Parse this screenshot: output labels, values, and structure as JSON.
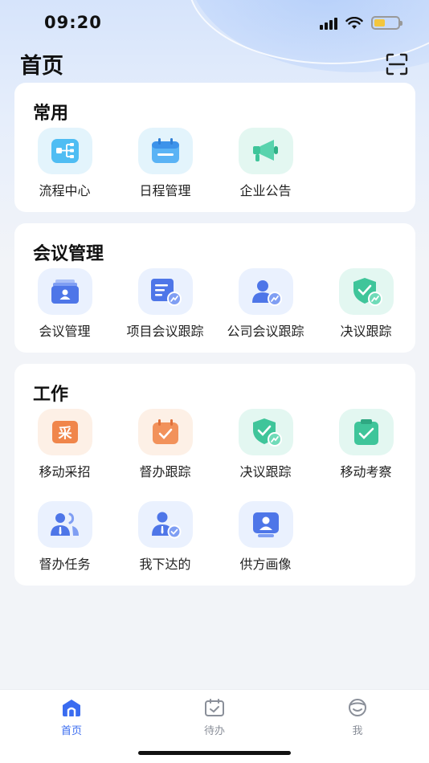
{
  "status_bar": {
    "time": "09:20"
  },
  "header": {
    "title": "首页"
  },
  "sections": {
    "common": {
      "title": "常用",
      "items": [
        {
          "label": "流程中心",
          "icon": "flow-icon"
        },
        {
          "label": "日程管理",
          "icon": "calendar-icon"
        },
        {
          "label": "企业公告",
          "icon": "megaphone-icon"
        }
      ]
    },
    "meeting": {
      "title": "会议管理",
      "items": [
        {
          "label": "会议管理",
          "icon": "meeting-icon"
        },
        {
          "label": "项目会议跟踪",
          "icon": "project-tracking-icon"
        },
        {
          "label": "公司会议跟踪",
          "icon": "company-tracking-icon"
        },
        {
          "label": "决议跟踪",
          "icon": "resolution-shield-icon"
        }
      ]
    },
    "work": {
      "title": "工作",
      "items": [
        {
          "label": "移动采招",
          "icon": "procurement-icon",
          "badge": "采"
        },
        {
          "label": "督办跟踪",
          "icon": "supervise-calendar-icon"
        },
        {
          "label": "决议跟踪",
          "icon": "resolution-shield-icon"
        },
        {
          "label": "移动考察",
          "icon": "clipboard-check-icon"
        },
        {
          "label": "督办任务",
          "icon": "team-task-icon"
        },
        {
          "label": "我下达的",
          "icon": "issued-user-icon"
        },
        {
          "label": "供方画像",
          "icon": "supplier-profile-icon"
        }
      ]
    }
  },
  "tabbar": {
    "items": [
      {
        "label": "首页",
        "active": true,
        "icon": "home-icon"
      },
      {
        "label": "待办",
        "active": false,
        "icon": "todo-calendar-icon"
      },
      {
        "label": "我",
        "active": false,
        "icon": "profile-icon"
      }
    ]
  },
  "colors": {
    "accent": "#3a6cf0",
    "tab_inactive": "#8a8f99"
  }
}
